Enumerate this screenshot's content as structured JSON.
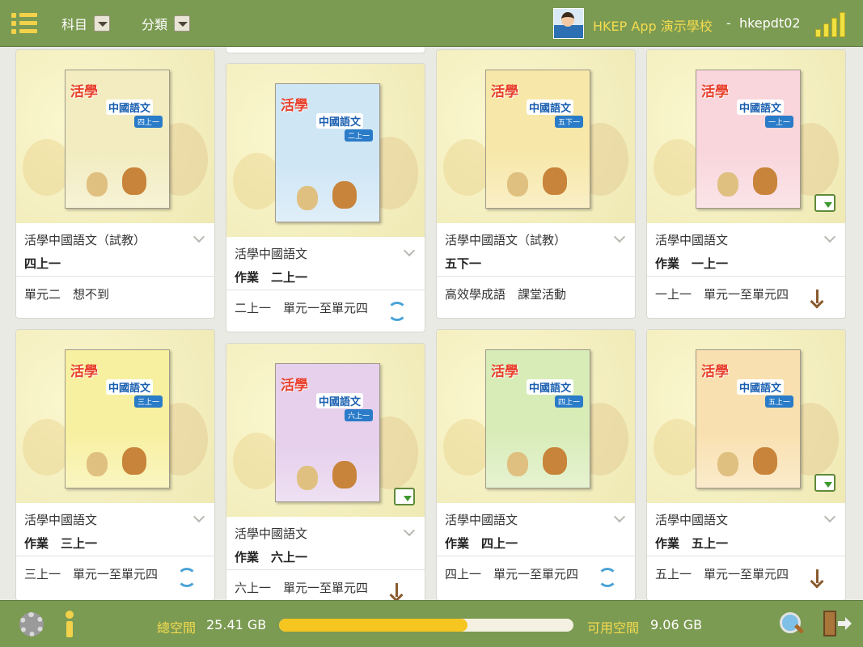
{
  "header": {
    "filters": [
      {
        "label": "科目"
      },
      {
        "label": "分類"
      }
    ],
    "school": "HKEP App 演示學校",
    "separator": "-",
    "user": "hkepdt02"
  },
  "books": [
    {
      "cover_title": "活學",
      "cover_subtitle": "中國語文",
      "cover_tag": "四上一",
      "title": "活學中國語文（試教）",
      "subtitle": "四上一",
      "note": "單元二　想不到",
      "action": "none",
      "cover_color": "#f2ecc0",
      "download_badge": false
    },
    {
      "cover_title": "活學",
      "cover_subtitle": "中國語文",
      "cover_tag": "二上一",
      "title": "活學中國語文",
      "subtitle": "作業　二上一",
      "note": "二上一　單元一至單元四",
      "action": "sync-icon",
      "cover_color": "#cfe6f5",
      "download_badge": false
    },
    {
      "cover_title": "活學",
      "cover_subtitle": "中國語文",
      "cover_tag": "五下一",
      "title": "活學中國語文（試教）",
      "subtitle": "五下一",
      "note": "高效學成語　課堂活動",
      "action": "none",
      "cover_color": "#f7e7a8",
      "download_badge": false
    },
    {
      "cover_title": "活學",
      "cover_subtitle": "中國語文",
      "cover_tag": "一上一",
      "title": "活學中國語文",
      "subtitle": "作業　一上一",
      "note": "一上一　單元一至單元四",
      "action": "download-arrow-icon",
      "cover_color": "#f8d6dc",
      "download_badge": true
    },
    {
      "cover_title": "活學",
      "cover_subtitle": "中國語文",
      "cover_tag": "三上一",
      "title": "活學中國語文",
      "subtitle": "作業　三上一",
      "note": "三上一　單元一至單元四",
      "action": "sync-icon",
      "cover_color": "#f7f0a0",
      "download_badge": false
    },
    {
      "cover_title": "活學",
      "cover_subtitle": "中國語文",
      "cover_tag": "六上一",
      "title": "活學中國語文",
      "subtitle": "作業　六上一",
      "note": "六上一　單元一至單元四",
      "action": "download-arrow-icon",
      "cover_color": "#e6d0ec",
      "download_badge": true
    },
    {
      "cover_title": "活學",
      "cover_subtitle": "中國語文",
      "cover_tag": "四上一",
      "title": "活學中國語文",
      "subtitle": "作業　四上一",
      "note": "四上一　單元一至單元四",
      "action": "sync-icon",
      "cover_color": "#d8ecb8",
      "download_badge": false
    },
    {
      "cover_title": "活學",
      "cover_subtitle": "中國語文",
      "cover_tag": "五上一",
      "title": "活學中國語文",
      "subtitle": "作業　五上一",
      "note": "五上一　單元一至單元四",
      "action": "download-arrow-icon",
      "cover_color": "#f9e0b0",
      "download_badge": true
    }
  ],
  "footer": {
    "total_label": "總空間",
    "total_value": "25.41 GB",
    "free_label": "可用空間",
    "free_value": "9.06 GB",
    "used_fraction": 0.64
  },
  "colors": {
    "bar_green": "#7b9a52",
    "accent_yellow": "#f5dc4f",
    "progress_fill": "#f5c520",
    "sync_blue": "#4aa3d6",
    "download_brown": "#8a5a2e"
  }
}
